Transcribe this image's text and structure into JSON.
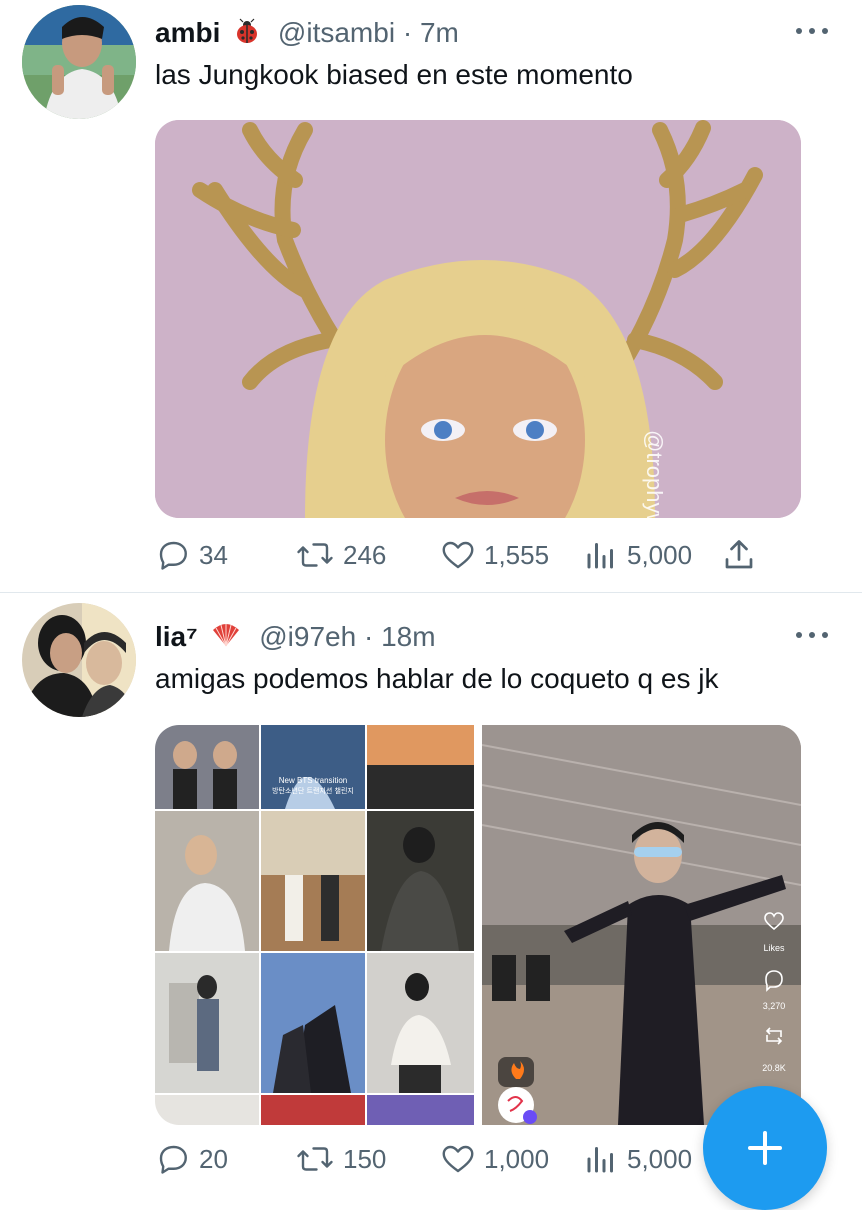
{
  "tweets": [
    {
      "name": "ambi",
      "handle": "@itsambi",
      "dot": "·",
      "time": "7m",
      "text": "las Jungkook biased en este momento",
      "watermark": "@trophyw",
      "stats": {
        "replies": "34",
        "retweets": "246",
        "likes": "1,555",
        "views": "5,000"
      }
    },
    {
      "name": "lia⁷",
      "handle": "@i97eh",
      "dot": "·",
      "time": "18m",
      "text": "amigas podemos hablar de lo coqueto q es jk",
      "grid_label_line1": "New BTS transition",
      "grid_label_line2": "방탄소년단 트랜지션 챌린지",
      "video_side": {
        "likes_label": "Likes",
        "comments": "3,270",
        "shares": "20.8K"
      },
      "stats": {
        "replies": "20",
        "retweets": "150",
        "likes": "1,000",
        "views": "5,000"
      }
    }
  ],
  "colors": {
    "accent": "#1d9bf0",
    "meta": "#536471",
    "text": "#0f1419"
  },
  "icons": [
    "more-icon",
    "reply-icon",
    "retweet-icon",
    "like-icon",
    "views-icon",
    "share-icon",
    "compose-plus-icon"
  ]
}
